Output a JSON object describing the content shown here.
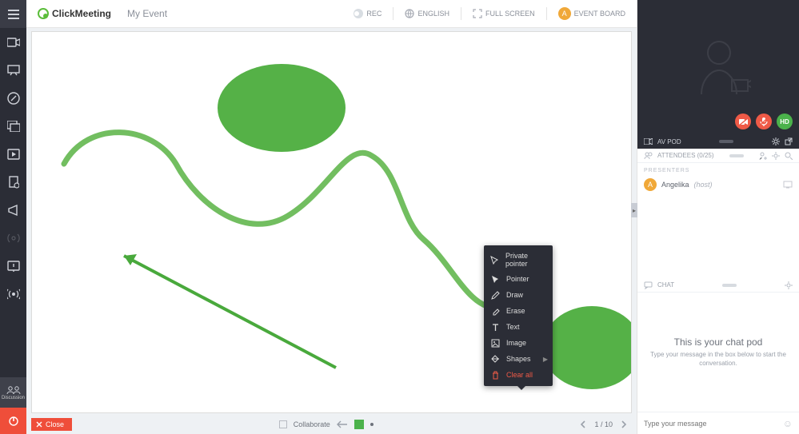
{
  "header": {
    "brand": "ClickMeeting",
    "event_name": "My Event",
    "rec_label": "REC",
    "language": "ENGLISH",
    "fullscreen": "FULL SCREEN",
    "event_board": "EVENT BOARD",
    "avatar_letter": "A"
  },
  "sidebar_left": {
    "discussion_label": "Discussion"
  },
  "colors": {
    "accent_green": "#4bb24b",
    "brand_green": "#5bbd3a",
    "danger": "#ef4e3a",
    "dark": "#2b2d36"
  },
  "tools_menu": {
    "items": [
      {
        "key": "private_pointer",
        "label": "Private pointer",
        "icon": "pointer-outline"
      },
      {
        "key": "pointer",
        "label": "Pointer",
        "icon": "pointer-filled"
      },
      {
        "key": "draw",
        "label": "Draw",
        "icon": "pencil"
      },
      {
        "key": "erase",
        "label": "Erase",
        "icon": "eraser"
      },
      {
        "key": "text",
        "label": "Text",
        "icon": "text"
      },
      {
        "key": "image",
        "label": "Image",
        "icon": "image"
      },
      {
        "key": "shapes",
        "label": "Shapes",
        "icon": "shapes",
        "submenu": true
      },
      {
        "key": "clear_all",
        "label": "Clear all",
        "icon": "trash",
        "danger": true
      }
    ]
  },
  "bottom_bar": {
    "close": "Close",
    "collaborate": "Collaborate",
    "page": "1 / 10"
  },
  "av_pod": {
    "title": "AV POD",
    "hd_label": "HD"
  },
  "attendees": {
    "title": "ATTENDEES (0/25)",
    "section_label": "PRESENTERS",
    "list": [
      {
        "avatar": "A",
        "name": "Angelika",
        "role": "(host)"
      }
    ]
  },
  "chat": {
    "title": "CHAT",
    "empty_title": "This is your chat pod",
    "empty_sub": "Type your message in the box below to start the conversation.",
    "placeholder": "Type your message"
  }
}
